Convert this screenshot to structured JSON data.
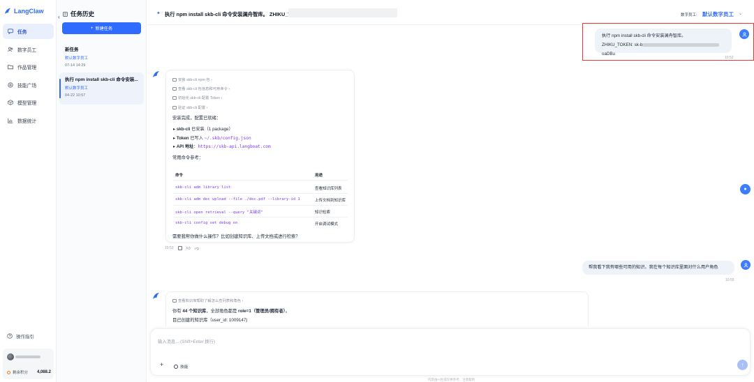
{
  "brand": {
    "name": "LangClaw",
    "color": "#2f6bff"
  },
  "sidebar": {
    "items": [
      {
        "label": "任务",
        "icon": "chat-icon",
        "active": true
      },
      {
        "label": "数字员工",
        "icon": "people-icon"
      },
      {
        "label": "作品管理",
        "icon": "folder-icon"
      },
      {
        "label": "技能广场",
        "icon": "skill-icon"
      },
      {
        "label": "模型管理",
        "icon": "cube-icon"
      },
      {
        "label": "数据统计",
        "icon": "chart-icon"
      }
    ],
    "guide_label": "操作指引",
    "points_label": "剩余积分",
    "points_value": "4,088.2"
  },
  "history": {
    "title": "任务历史",
    "new_task_label": "新建任务",
    "tasks": [
      {
        "title": "新任务",
        "tag": "默认数字员工",
        "time": "07-14 14:29"
      },
      {
        "title": "执行 npm install skb-cli 命令安装...",
        "tag": "默认数字员工",
        "time": "04-22 10:57"
      }
    ]
  },
  "topbar": {
    "title": "执行 npm install skb-cli 命令安装澜舟智库。 ZHIKU_TOKE",
    "employee_label": "数字员工:",
    "employee_value": "默认数字员工"
  },
  "messages": {
    "user1": {
      "line1": "执行 npm install skb-cli 命令安装澜舟智库。",
      "line2_prefix": "ZHIKU_TOKEN: sk-b",
      "line2_suffix": "oaDBu",
      "time": "10:52"
    },
    "bot1": {
      "steps": [
        "安装 skb-cli npm 包",
        "查看 skb-cli 包信息和可用命令",
        "初始化 skb-cli 配置 Token",
        "验证 skb-cli 配置"
      ],
      "done": "安装完成，配置已就绪：",
      "bullets": [
        {
          "key": "skb-cli",
          "text": " 已安装（1 package）"
        },
        {
          "key": "Token",
          "text": " 已写入 ",
          "code": "~/.skb/config.json"
        },
        {
          "key": "API 地址",
          "text": "：",
          "code": "https://skb-api.langboat.com"
        }
      ],
      "ref_title": "常用命令参考：",
      "table_head": {
        "cmd": "命令",
        "desc": "用途"
      },
      "rows": [
        {
          "cmd": "skb-cli adm library list",
          "desc": "查看知识库列表"
        },
        {
          "cmd": "skb-cli adm doc upload --file ./doc.pdf --library-id 1",
          "desc": "上传文档到知识库"
        },
        {
          "cmd": "skb-cli open retrieval --query \"关键词\"",
          "desc": "知识检索"
        },
        {
          "cmd": "skb-cli config set debug on",
          "desc": "开启调试模式"
        }
      ],
      "followup": "需要我帮你做什么操作？比如创建知识库、上传文档或进行检索？",
      "time": "10:53"
    },
    "user2": {
      "text": "帮我看下我有哪些可用的知识，我在每个知识库里面对什么用户角色",
      "time": "10:55"
    },
    "bot2": {
      "step": "查看知识库帮助了解怎么查列表和角色",
      "line1_a": "你有 ",
      "line1_b": "44 个知识库",
      "line1_c": "，全部角色都是 ",
      "line1_d": "role=1（管理员/拥有者）",
      "line1_e": "。",
      "line2": "目己创建的知识库（user_id: 1009147)"
    }
  },
  "input": {
    "placeholder": "输入消息... (Shift+Enter 换行)",
    "skill_label": "技能",
    "disclaimer": "内容由AI生成仅供参考，注意甄别"
  }
}
